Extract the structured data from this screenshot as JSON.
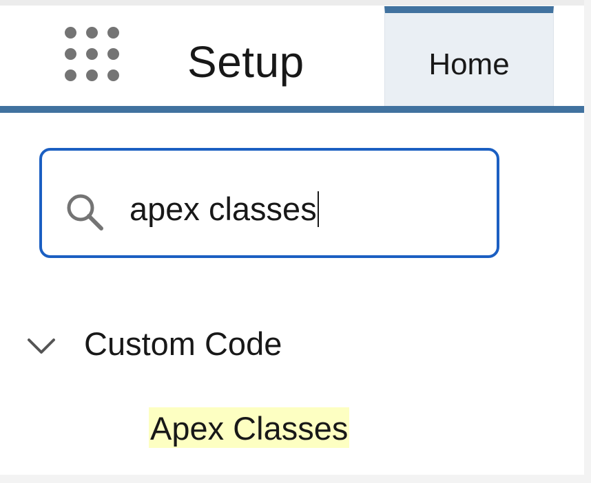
{
  "header": {
    "app_launcher_icon": "app-launcher-icon",
    "app_title": "Setup",
    "tabs": [
      {
        "label": "Home",
        "selected": true
      }
    ],
    "accent_color": "#41729f"
  },
  "search": {
    "icon": "search-icon",
    "value": "apex classes",
    "focus_color": "#1b5fc2"
  },
  "tree": {
    "section": {
      "icon": "chevron-down-icon",
      "label": "Custom Code",
      "expanded": true
    },
    "items": [
      {
        "label": "Apex Classes",
        "highlight_color": "#fdffc2"
      }
    ]
  }
}
